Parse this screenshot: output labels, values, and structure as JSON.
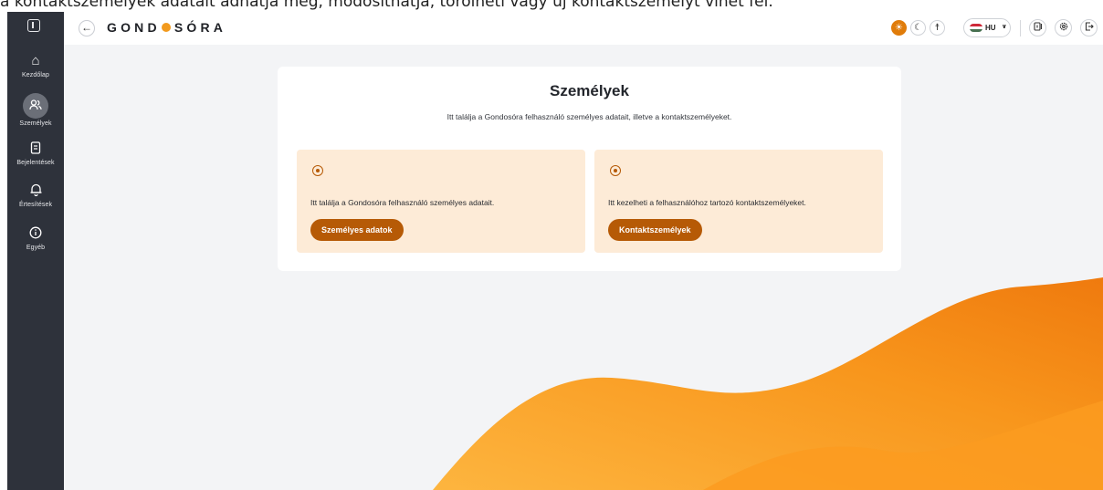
{
  "top_caption": "a kontaktszemélyek adatait adhatja meg, módosíthatja, törölheti vagy új kontaktszemélyt vihet fel.",
  "header": {
    "back_icon": "arrow-left-icon",
    "logo_left": "GOND",
    "logo_right": "SÓRA",
    "modes": [
      {
        "name": "light",
        "icon": "sun-icon",
        "glyph": "☀",
        "active": true
      },
      {
        "name": "dark",
        "icon": "moon-icon",
        "glyph": "☾",
        "active": false
      },
      {
        "name": "accessibility",
        "icon": "accessibility-icon",
        "glyph": "☨",
        "active": false
      }
    ],
    "language": "HU",
    "right_icons": [
      "exit-door-icon",
      "settings-icon",
      "logout-icon"
    ]
  },
  "sidebar": {
    "items": [
      {
        "label": "Kezdőlap",
        "icon": "home-icon",
        "active": false
      },
      {
        "label": "Személyek",
        "icon": "people-icon",
        "active": true
      },
      {
        "label": "Bejelentések",
        "icon": "document-icon",
        "active": false
      },
      {
        "label": "Értesítések",
        "icon": "bell-icon",
        "active": false
      },
      {
        "label": "Egyéb",
        "icon": "info-icon",
        "active": false
      }
    ]
  },
  "main": {
    "title": "Személyek",
    "description": "Itt találja a Gondosóra felhasználó személyes adatait, illetve a kontaktszemélyeket.",
    "cards": [
      {
        "icon": "person-pin-icon",
        "text": "Itt találja a Gondosóra felhasználó személyes adatait.",
        "button": "Személyes adatok"
      },
      {
        "icon": "contact-pin-icon",
        "text": "Itt kezelheti a felhasználóhoz tartozó kontaktszemélyeket.",
        "button": "Kontaktszemélyek"
      }
    ]
  },
  "colors": {
    "accent": "#b65a06",
    "sidebar_bg": "#2e323b",
    "card_tint": "#fdebd7",
    "wave_light": "#fbb13c",
    "wave_dark": "#ee7d10"
  }
}
